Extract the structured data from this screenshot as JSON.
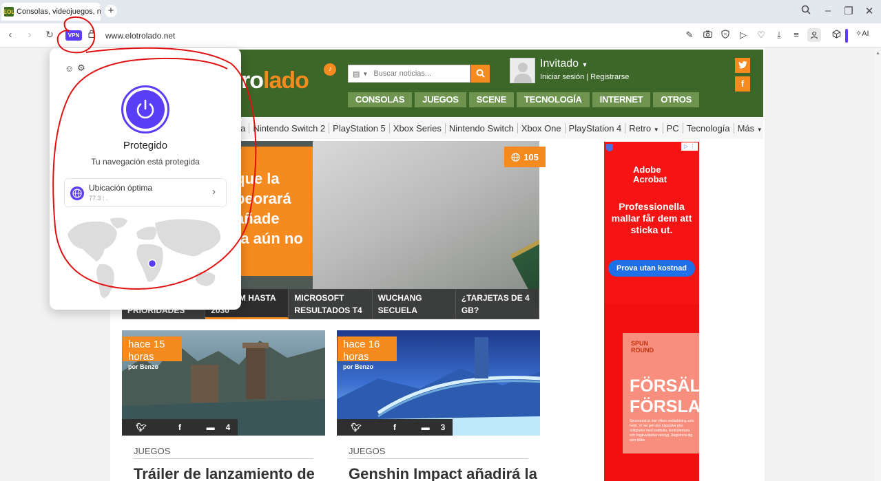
{
  "browser": {
    "tab_title": "Consolas, videojuegos, nu",
    "url": "www.elotrolado.net",
    "vpn_label": "VPN",
    "ai_label": "AI"
  },
  "site": {
    "logo_part1": "ro",
    "logo_part2": "lado",
    "search_placeholder": "Buscar noticias...",
    "user_name": "Invitado",
    "user_links": "Iniciar sesión | Registrarse",
    "categories": [
      "CONSOLAS",
      "JUEGOS",
      "SCENE",
      "TECNOLOGÍA",
      "INTERNET",
      "OTROS"
    ],
    "platforms": [
      "rma",
      "Nintendo Switch 2",
      "PlayStation 5",
      "Xbox Series",
      "Nintendo Switch",
      "Xbox One",
      "PlayStation 4",
      "Retro",
      "PC",
      "Tecnología",
      "Más"
    ]
  },
  "hero": {
    "lines": [
      "que la",
      "peorará",
      "añade",
      "ta aún no"
    ],
    "comment_count": "105",
    "strip": [
      {
        "line1": "",
        "line2": "PRIORIDADES"
      },
      {
        "line1": "SIN RAM HASTA",
        "line2": "2030"
      },
      {
        "line1": "MICROSOFT",
        "line2": "RESULTADOS T4"
      },
      {
        "line1": "WUCHANG",
        "line2": "SECUELA"
      },
      {
        "line1": "¿TARJETAS DE 4",
        "line2": "GB?"
      }
    ]
  },
  "cards": [
    {
      "time": "hace 15 horas",
      "author": "por Benzo",
      "comments": "4",
      "category": "JUEGOS",
      "title": "Tráiler de lanzamiento de"
    },
    {
      "time": "hace 16 horas",
      "author": "por Benzo",
      "comments": "3",
      "category": "JUEGOS",
      "title": "Genshin Impact añadirá la"
    }
  ],
  "ad": {
    "brand_line1": "Adobe",
    "brand_line2": "Acrobat",
    "headline": "Professionella mallar får dem att sticka ut.",
    "cta": "Prova utan kostnad",
    "bottom_brand1": "SPUN",
    "bottom_brand2": "ROUND",
    "bottom_headline1": "FÖRSÄLJN",
    "bottom_headline2": "FÖRSLA",
    "bottom_small": "Spunround är inte vilken nedladdning som helst. Vi har gett den klassiska pho-rättigheter med kraftfulla, kontrollerbara och högkvalitativa verktyg. Registrera dig som tillåts"
  },
  "vpn": {
    "status": "Protegido",
    "description": "Tu navegación está protegida",
    "location_title": "Ubicación óptima",
    "location_ip": "77.3 : .",
    "accent": "#5a3df6"
  }
}
